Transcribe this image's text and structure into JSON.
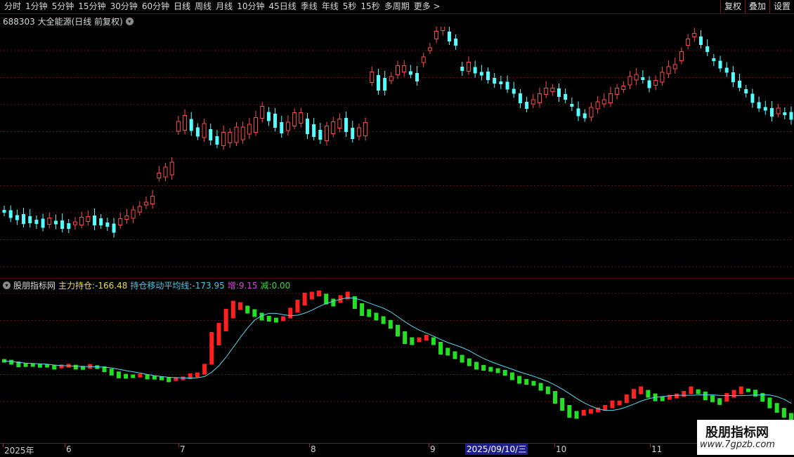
{
  "toolbar": {
    "periods": [
      "分时",
      "1分钟",
      "5分钟",
      "15分钟",
      "30分钟",
      "60分钟",
      "日线",
      "周线",
      "月线",
      "10分钟",
      "45日线",
      "季线",
      "年线",
      "5秒",
      "15秒",
      "多周期",
      "更多 >"
    ],
    "active": "日线",
    "right_buttons": [
      "复权",
      "叠加",
      "设置"
    ]
  },
  "stock_title": "688303 大全能源(日线 前复权)",
  "indicator": {
    "name": "股朋指标网",
    "items": [
      {
        "label": "主力持仓:",
        "value": "-166.48",
        "color": "#e8e04a"
      },
      {
        "label": "持仓移动平均线:",
        "value": "-173.95",
        "color": "#46c8e8"
      },
      {
        "label": "增:",
        "value": "9.15",
        "color": "#e040e0"
      },
      {
        "label": "减:",
        "value": "0.00",
        "color": "#3cd83c"
      }
    ]
  },
  "time_axis": {
    "labels": [
      "2025年",
      "6",
      "7",
      "8",
      "9",
      "10",
      "11"
    ],
    "cursor_date": "2025/09/10/三"
  },
  "watermark": {
    "title": "股朋指标网",
    "url": "www.7gpzb.com"
  },
  "colors": {
    "up": "#ff4a4a",
    "down": "#54ffff",
    "ma_line": "#5ad8f0",
    "bar_up": "#ff2020",
    "bar_down": "#22e022",
    "grid": "#6a1010"
  }
}
